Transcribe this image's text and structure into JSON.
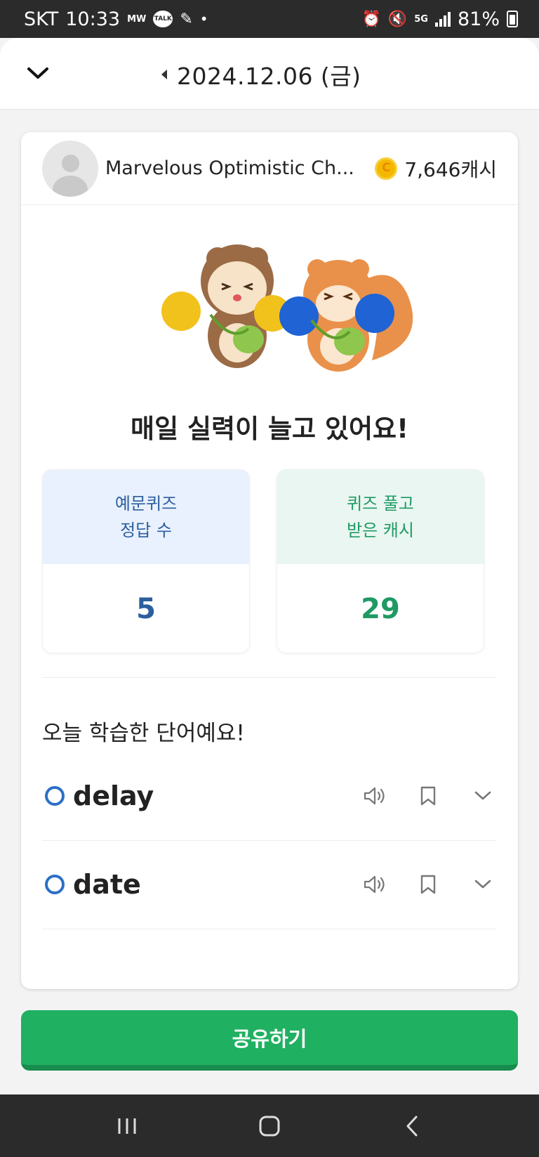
{
  "status_bar": {
    "carrier": "SKT",
    "time": "10:33",
    "mini_icon_label": "MW",
    "talk_label": "TALK",
    "network": "5G",
    "battery_percent": "81%"
  },
  "header": {
    "date": "2024.12.06 (금)"
  },
  "profile": {
    "name": "Marvelous Optimistic Ch...",
    "cash": "7,646캐시"
  },
  "headline": "매일 실력이 늘고 있어요!",
  "stats": {
    "quiz_label_line1": "예문퀴즈",
    "quiz_label_line2": "정답 수",
    "quiz_value": "5",
    "cash_label_line1": "퀴즈 풀고",
    "cash_label_line2": "받은 캐시",
    "cash_value": "29"
  },
  "words_section": {
    "title": "오늘 학습한 단어예요!",
    "words": [
      {
        "word": "delay"
      },
      {
        "word": "date"
      }
    ]
  },
  "share_button": "공유하기",
  "colors": {
    "accent_green": "#20b062",
    "stat_blue": "#2d5e9e",
    "stat_green": "#1f9a64",
    "word_circle": "#2d6fc7"
  }
}
